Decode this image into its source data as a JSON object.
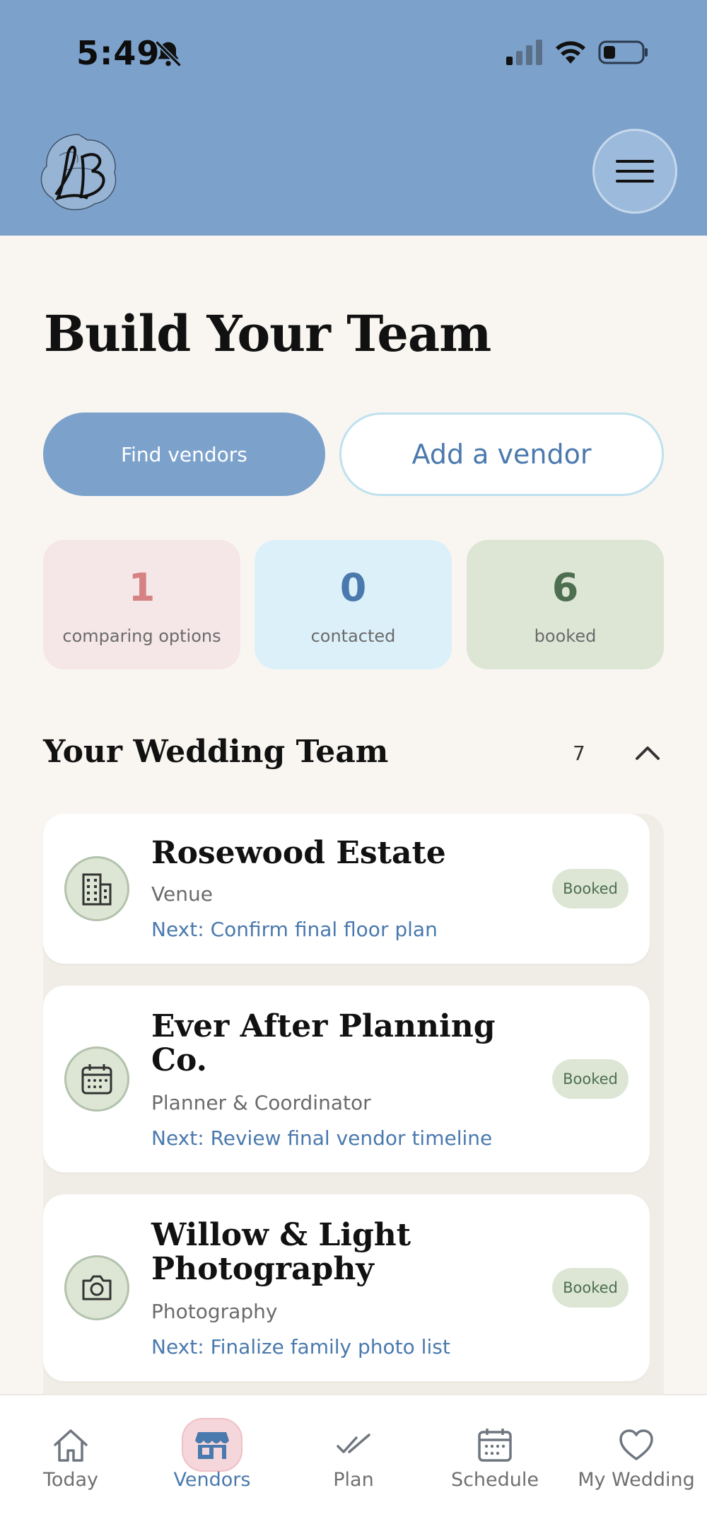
{
  "status_bar": {
    "time": "5:49"
  },
  "header": {
    "logo_text": "LB",
    "menu_icon": "hamburger-menu-icon"
  },
  "page": {
    "title": "Build Your Team"
  },
  "actions": {
    "find_vendors": "Find vendors",
    "add_vendor": "Add a vendor"
  },
  "stats": [
    {
      "value": "1",
      "label": "comparing options"
    },
    {
      "value": "0",
      "label": "contacted"
    },
    {
      "value": "6",
      "label": "booked"
    }
  ],
  "team_section": {
    "title": "Your Wedding Team",
    "count": "7"
  },
  "vendors": [
    {
      "name": "Rosewood Estate",
      "category": "Venue",
      "next": "Next: Confirm final floor plan",
      "status": "Booked",
      "icon": "building-icon"
    },
    {
      "name": "Ever After Planning Co.",
      "category": "Planner & Coordinator",
      "next": "Next: Review final vendor timeline",
      "status": "Booked",
      "icon": "calendar-icon"
    },
    {
      "name": "Willow & Light Photography",
      "category": "Photography",
      "next": "Next: Finalize family photo list",
      "status": "Booked",
      "icon": "camera-icon"
    }
  ],
  "tabs": [
    {
      "label": "Today",
      "icon": "home-icon"
    },
    {
      "label": "Vendors",
      "icon": "storefront-icon",
      "active": true
    },
    {
      "label": "Plan",
      "icon": "double-check-icon"
    },
    {
      "label": "Schedule",
      "icon": "calendar-icon"
    },
    {
      "label": "My Wedding",
      "icon": "heart-icon"
    }
  ],
  "colors": {
    "header_bg": "#7ca2cc",
    "page_bg": "#f9f6f1",
    "accent_blue": "#4a79ad",
    "booked_green": "#dde6d5",
    "compare_pink": "#f5e6e8",
    "contacted_blue": "#dcf0fa"
  }
}
